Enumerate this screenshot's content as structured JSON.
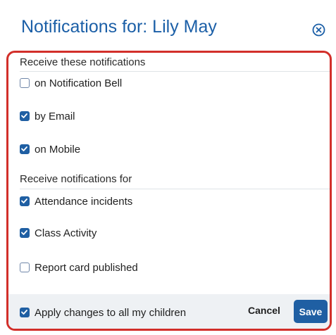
{
  "dialog": {
    "title": "Notifications for: Lily May",
    "close_icon": "close-circle-icon"
  },
  "channels": {
    "heading": "Receive these notifications",
    "options": [
      {
        "label": "on Notification Bell",
        "checked": false
      },
      {
        "label": "by Email",
        "checked": true
      },
      {
        "label": "on Mobile",
        "checked": true
      }
    ]
  },
  "types": {
    "heading": "Receive notifications for",
    "options": [
      {
        "label": "Attendance incidents",
        "checked": true
      },
      {
        "label": "Class Activity",
        "checked": true
      },
      {
        "label": "Report card published",
        "checked": false
      }
    ]
  },
  "footer": {
    "apply_label": "Apply changes to all my children",
    "apply_checked": true,
    "cancel_label": "Cancel",
    "save_label": "Save"
  },
  "colors": {
    "title": "#1b5fa3",
    "accent": "#1f5fa3",
    "highlight_border": "#d22f2a",
    "footer_bg": "#eef1f4"
  }
}
